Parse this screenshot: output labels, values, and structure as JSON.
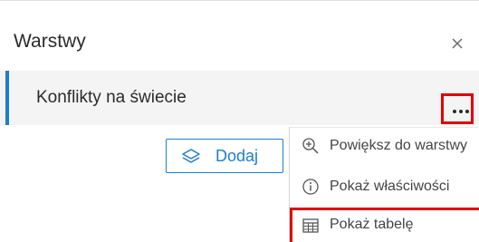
{
  "panel": {
    "title": "Warstwy",
    "close_icon": "close-icon"
  },
  "layer": {
    "name": "Konflikty na świecie",
    "accent_color": "#1f7ec9",
    "more_icon": "more-horizontal-icon"
  },
  "add_button": {
    "label": "Dodaj",
    "icon": "layers-icon"
  },
  "menu": {
    "items": [
      {
        "label": "Powiększ do warstwy",
        "icon": "zoom-in-icon"
      },
      {
        "label": "Pokaż właściwości",
        "icon": "info-icon"
      },
      {
        "label": "Pokaż tabelę",
        "icon": "table-icon"
      }
    ]
  },
  "colors": {
    "accent": "#1f7ec9",
    "highlight": "#e00000"
  }
}
